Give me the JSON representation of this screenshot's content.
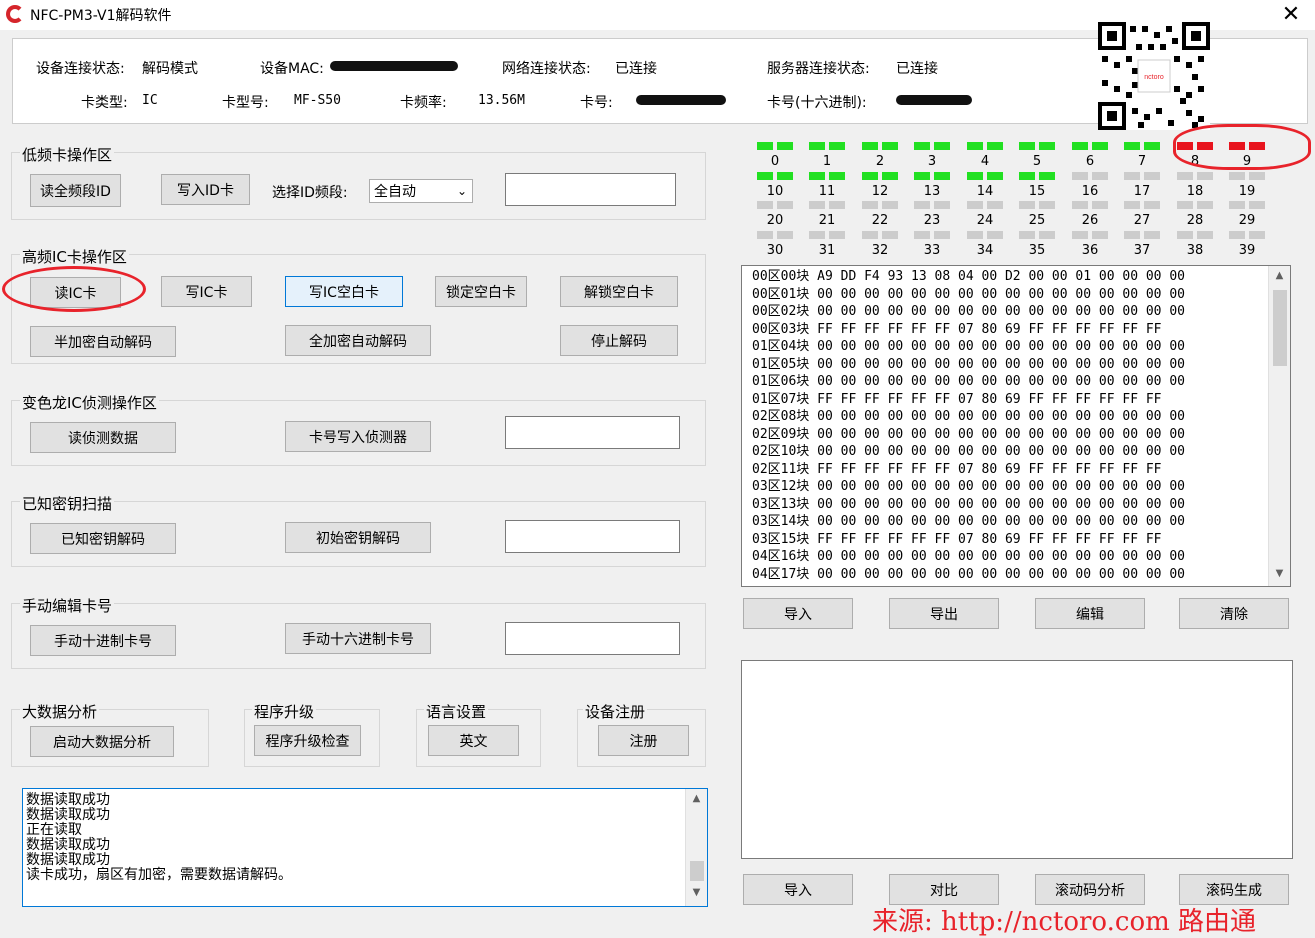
{
  "window": {
    "title": "NFC-PM3-V1解码软件"
  },
  "status": {
    "conn_label": "设备连接状态:",
    "conn_value": "解码模式",
    "mac_label": "设备MAC:",
    "net_label": "网络连接状态:",
    "net_value": "已连接",
    "server_label": "服务器连接状态:",
    "server_value": "已连接",
    "type_label": "卡类型:",
    "type_value": "IC",
    "model_label": "卡型号:",
    "model_value": "MF-S50",
    "freq_label": "卡频率:",
    "freq_value": "13.56M",
    "cardno_label": "卡号:",
    "cardhex_label": "卡号(十六进制):"
  },
  "qr": {
    "brand": "nctoro"
  },
  "lf": {
    "title": "低频卡操作区",
    "read_all": "读全频段ID",
    "write_id": "写入ID卡",
    "band_label": "选择ID频段:",
    "band_value": "全自动"
  },
  "hf": {
    "title": "高频IC卡操作区",
    "read_ic": "读IC卡",
    "write_ic": "写IC卡",
    "write_blank": "写IC空白卡",
    "lock_blank": "锁定空白卡",
    "unlock_blank": "解锁空白卡",
    "half_decode": "半加密自动解码",
    "full_decode": "全加密自动解码",
    "stop_decode": "停止解码"
  },
  "cham": {
    "title": "变色龙IC侦测操作区",
    "read_detect": "读侦测数据",
    "write_detect": "卡号写入侦测器"
  },
  "known": {
    "title": "已知密钥扫描",
    "known_decode": "已知密钥解码",
    "init_decode": "初始密钥解码"
  },
  "manual": {
    "title": "手动编辑卡号",
    "dec": "手动十进制卡号",
    "hex": "手动十六进制卡号"
  },
  "bigdata": {
    "title": "大数据分析",
    "btn": "启动大数据分析"
  },
  "upgrade": {
    "title": "程序升级",
    "btn": "程序升级检查"
  },
  "lang": {
    "title": "语言设置",
    "btn": "英文"
  },
  "reg": {
    "title": "设备注册",
    "btn": "注册"
  },
  "sectors": {
    "labels": [
      "0",
      "1",
      "2",
      "3",
      "4",
      "5",
      "6",
      "7",
      "8",
      "9",
      "10",
      "11",
      "12",
      "13",
      "14",
      "15",
      "16",
      "17",
      "18",
      "19",
      "20",
      "21",
      "22",
      "23",
      "24",
      "25",
      "26",
      "27",
      "28",
      "29",
      "30",
      "31",
      "32",
      "33",
      "34",
      "35",
      "36",
      "37",
      "38",
      "39"
    ],
    "states": [
      "g",
      "g",
      "g",
      "g",
      "g",
      "g",
      "g",
      "g",
      "r",
      "r",
      "g",
      "g",
      "g",
      "g",
      "g",
      "g",
      "x",
      "x",
      "x",
      "x",
      "x",
      "x",
      "x",
      "x",
      "x",
      "x",
      "x",
      "x",
      "x",
      "x",
      "x",
      "x",
      "x",
      "x",
      "x",
      "x",
      "x",
      "x",
      "x",
      "x"
    ],
    "colors": {
      "g": "#22e022",
      "r": "#e8141e",
      "x": "#cccccc"
    }
  },
  "hex_rows": [
    "00区00块 A9 DD F4 93 13 08 04 00 D2 00 00 01 00 00 00 00",
    "00区01块 00 00 00 00 00 00 00 00 00 00 00 00 00 00 00 00",
    "00区02块 00 00 00 00 00 00 00 00 00 00 00 00 00 00 00 00",
    "00区03块 FF FF FF FF FF FF 07 80 69 FF FF FF FF FF FF",
    "01区04块 00 00 00 00 00 00 00 00 00 00 00 00 00 00 00 00",
    "01区05块 00 00 00 00 00 00 00 00 00 00 00 00 00 00 00 00",
    "01区06块 00 00 00 00 00 00 00 00 00 00 00 00 00 00 00 00",
    "01区07块 FF FF FF FF FF FF 07 80 69 FF FF FF FF FF FF",
    "02区08块 00 00 00 00 00 00 00 00 00 00 00 00 00 00 00 00",
    "02区09块 00 00 00 00 00 00 00 00 00 00 00 00 00 00 00 00",
    "02区10块 00 00 00 00 00 00 00 00 00 00 00 00 00 00 00 00",
    "02区11块 FF FF FF FF FF FF 07 80 69 FF FF FF FF FF FF",
    "03区12块 00 00 00 00 00 00 00 00 00 00 00 00 00 00 00 00",
    "03区13块 00 00 00 00 00 00 00 00 00 00 00 00 00 00 00 00",
    "03区14块 00 00 00 00 00 00 00 00 00 00 00 00 00 00 00 00",
    "03区15块 FF FF FF FF FF FF 07 80 69 FF FF FF FF FF FF",
    "04区16块 00 00 00 00 00 00 00 00 00 00 00 00 00 00 00 00",
    "04区17块 00 00 00 00 00 00 00 00 00 00 00 00 00 00 00 00"
  ],
  "hex_buttons": {
    "import": "导入",
    "export": "导出",
    "edit": "编辑",
    "clear": "清除"
  },
  "bottom_buttons": {
    "import": "导入",
    "compare": "对比",
    "rolling": "滚动码分析",
    "generate": "滚码生成"
  },
  "log": [
    "数据读取成功",
    "数据读取成功",
    "正在读取",
    "数据读取成功",
    "数据读取成功",
    "读卡成功，扇区有加密，需要数据请解码。"
  ],
  "watermark": "来源: http://nctoro.com 路由通"
}
